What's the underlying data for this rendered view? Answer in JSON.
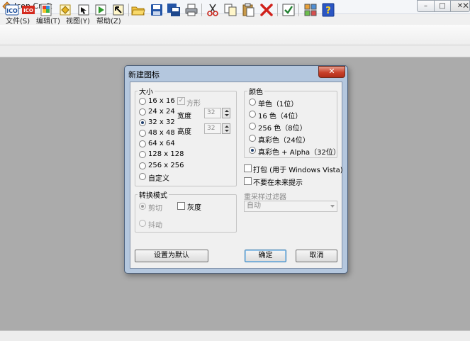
{
  "window": {
    "title": "Icon Craft",
    "minimize": "–",
    "maximize": "□",
    "close": "✕"
  },
  "menu": [
    "文件(S)",
    "编辑(T)",
    "视图(Y)",
    "帮助(Z)"
  ],
  "toolbar": [
    "ico-format-icon",
    "ico-red-icon",
    "palette-icon",
    "import-icon",
    "select-icon",
    "run-icon",
    "export-arrow-icon",
    "open-folder-icon",
    "save-icon",
    "save-all-icon",
    "print-icon",
    "cut-icon",
    "copy-icon",
    "paste-icon",
    "delete-icon",
    "check-icon",
    "grid-icon",
    "help-icon"
  ],
  "document": {
    "close": "✕"
  },
  "dialog": {
    "title": "新建图标",
    "close": "✕",
    "size_group": {
      "label": "大小",
      "options": [
        "16 x 16",
        "24 x 24",
        "32 x 32",
        "48 x 48",
        "64 x 64",
        "128 x 128",
        "256 x 256",
        "自定义"
      ],
      "selected": "32 x 32",
      "square_label": "方形",
      "square_checked": true,
      "width_label": "宽度",
      "width_value": "32",
      "height_label": "高度",
      "height_value": "32"
    },
    "color_group": {
      "label": "颜色",
      "options": [
        "单色（1位）",
        "16 色（4位）",
        "256 色（8位）",
        "真彩色（24位）",
        "真彩色 + Alpha（32位）"
      ],
      "selected": "真彩色 + Alpha（32位）"
    },
    "pack_label": "打包 (用于 Windows Vista)",
    "pack_checked": false,
    "no_prompt_label": "不要在未来提示",
    "no_prompt_checked": false,
    "resample_label": "重采样过滤器",
    "resample_value": "自动",
    "convert_group": {
      "label": "转换模式",
      "crop_label": "剪切",
      "crop_selected": true,
      "dither_label": "抖动",
      "dither_selected": false,
      "gray_label": "灰度",
      "gray_checked": false
    },
    "buttons": {
      "set_default": "设置为默认",
      "ok": "确定",
      "cancel": "取消"
    }
  },
  "colors": {
    "accent": "#1f3f6e",
    "close_red": "#c8402a",
    "workspace": "#ababab",
    "dialog_frame": "#b4c7de"
  }
}
